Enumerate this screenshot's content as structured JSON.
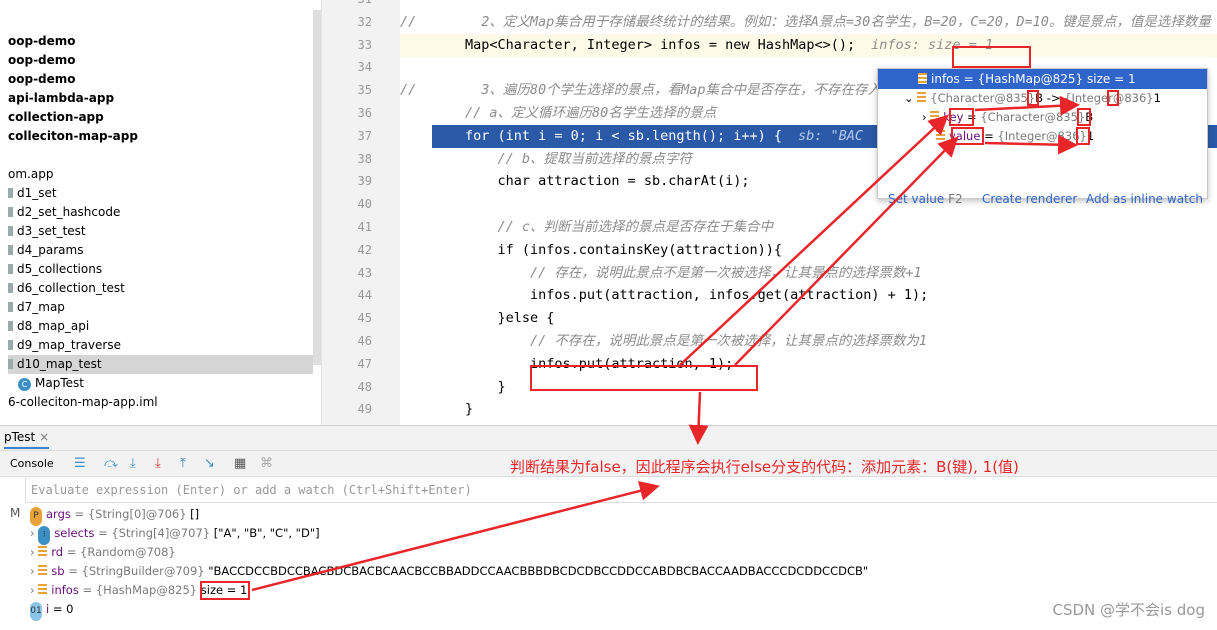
{
  "sidebar": {
    "items": [
      {
        "label": "oop-demo",
        "bold": true
      },
      {
        "label": "oop-demo",
        "bold": true
      },
      {
        "label": "oop-demo",
        "bold": true
      },
      {
        "label": "api-lambda-app",
        "bold": true
      },
      {
        "label": "collection-app",
        "bold": true
      },
      {
        "label": "colleciton-map-app",
        "bold": true
      },
      {
        "label": "",
        "bold": false
      },
      {
        "label": "om.app"
      },
      {
        "label": "d1_set"
      },
      {
        "label": "d2_set_hashcode"
      },
      {
        "label": "d3_set_test"
      },
      {
        "label": "d4_params"
      },
      {
        "label": "d5_collections"
      },
      {
        "label": "d6_collection_test"
      },
      {
        "label": "d7_map"
      },
      {
        "label": "d8_map_api"
      },
      {
        "label": "d9_map_traverse"
      },
      {
        "label": "d10_map_test"
      },
      {
        "label": "MapTest"
      },
      {
        "label": "6-colleciton-map-app.iml"
      }
    ]
  },
  "editor": {
    "lines": [
      {
        "n": "31",
        "html": ""
      },
      {
        "n": "32",
        "text": "//        2、定义Map集合用于存储最终统计的结果。例如：选择A景点=30名学生，B=20，C=20，D=10。键是景点，值是选择数量"
      },
      {
        "n": "33",
        "text": "        Map<Character, Integer> infos = new HashMap<>();",
        "inline": "infos: size = 1"
      },
      {
        "n": "34",
        "text": ""
      },
      {
        "n": "35",
        "text": "//        3、遍历80个学生选择的景点，看Map集合中是否存在，不存在存入"
      },
      {
        "n": "36",
        "text": "        // a、定义循环遍历80名学生选择的景点"
      },
      {
        "n": "37",
        "text": "        for (int i = 0; i < sb.length(); i++) {",
        "inline": "sb: \"BAC"
      },
      {
        "n": "38",
        "text": "            // b、提取当前选择的景点字符"
      },
      {
        "n": "39",
        "text": "            char attraction = sb.charAt(i);"
      },
      {
        "n": "40",
        "text": ""
      },
      {
        "n": "41",
        "text": "            // c、判断当前选择的景点是否存在于集合中"
      },
      {
        "n": "42",
        "text": "            if (infos.containsKey(attraction)){"
      },
      {
        "n": "43",
        "text": "                // 存在，说明此景点不是第一次被选择，让其景点的选择票数+1"
      },
      {
        "n": "44",
        "text": "                infos.put(attraction, infos.get(attraction) + 1);"
      },
      {
        "n": "45",
        "text": "            }else {"
      },
      {
        "n": "46",
        "text": "                // 不存在，说明此景点是第一次被选择，让其景点的选择票数为1"
      },
      {
        "n": "47",
        "text": "                infos.put(attraction, 1);"
      },
      {
        "n": "48",
        "text": "            }"
      },
      {
        "n": "49",
        "text": "        }"
      }
    ]
  },
  "popup": {
    "header": "infos = {HashMap@825}  size = 1",
    "entry": {
      "k": "{Character@835}",
      "kv": "B",
      "arrow": " -> ",
      "v": "{Integer@836}",
      "vv": "1"
    },
    "key": {
      "name": "key",
      "eq": " = ",
      "ref": "{Character@835}",
      "val": "B"
    },
    "value": {
      "name": "value",
      "eq": " = ",
      "ref": "{Integer@836}",
      "val": "1"
    },
    "set_value": "Set value",
    "set_value_key": "F2",
    "create_renderer": "Create renderer",
    "add_inline": "Add as inline watch"
  },
  "debug": {
    "tab": "pTest",
    "console": "Console",
    "eval_placeholder": "Evaluate expression (Enter) or add a watch (Ctrl+Shift+Enter)",
    "frame": "M",
    "vars": [
      {
        "name": "args",
        "ref": " = {String[0]@706} ",
        "val": "[]",
        "icon": "param"
      },
      {
        "name": "selects",
        "ref": " = {String[4]@707} ",
        "val": "[\"A\", \"B\", \"C\", \"D\"]",
        "icon": "array"
      },
      {
        "name": "rd",
        "ref": " = {Random@708}",
        "val": "",
        "icon": "field"
      },
      {
        "name": "sb",
        "ref": " = {StringBuilder@709} ",
        "val": "\"BACCDCCBDCCBACBDCBACBCAACBCCBBADDCCAACBBBDBCDCDBCCDDCCABDBCBACCAADBACCCDCDDCCDCB\"",
        "icon": "field"
      },
      {
        "name": "infos",
        "ref": " = {HashMap@825} ",
        "val": "size = 1",
        "icon": "field"
      },
      {
        "name": "i",
        "ref": " = 0",
        "val": "",
        "icon": "int"
      }
    ]
  },
  "annotation": {
    "note": "判断结果为false，因此程序会执行else分支的代码：添加元素：B(键), 1(值)",
    "color": "#e8262a"
  },
  "watermark": "CSDN @学不会is dog"
}
